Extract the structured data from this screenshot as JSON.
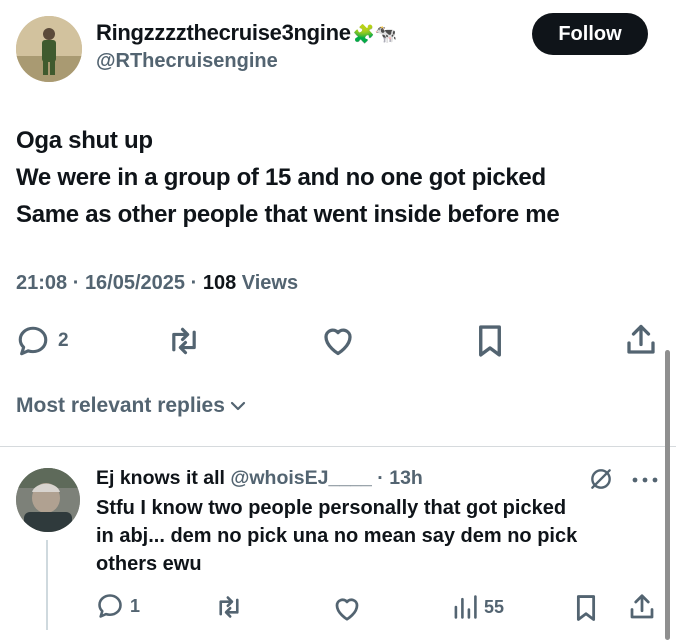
{
  "post": {
    "author_name": "Ringzzzzthecruise3ngine",
    "author_emojis": "🧩🐄",
    "handle": "@RThecruisengine",
    "follow_label": "Follow",
    "lines": [
      "Oga shut up",
      "We were in a group of 15 and no one got picked",
      "Same as other people that went inside before me"
    ],
    "time": "21:08",
    "date": "16/05/2025",
    "views_count": "108",
    "views_label": "Views",
    "reply_count": "2"
  },
  "replies_sort_label": "Most relevant replies",
  "reply": {
    "author_name": "Ej knows it all",
    "handle": "@whoisEJ____",
    "age": "13h",
    "lines": [
      "Stfu I know two people personally that got picked",
      "in abj... dem no pick una no mean say dem no pick",
      "others ewu"
    ],
    "reply_count": "1",
    "views_count": "55"
  },
  "colors": {
    "text": "#0f1419",
    "secondary": "#536471",
    "divider": "#d6dadd"
  }
}
